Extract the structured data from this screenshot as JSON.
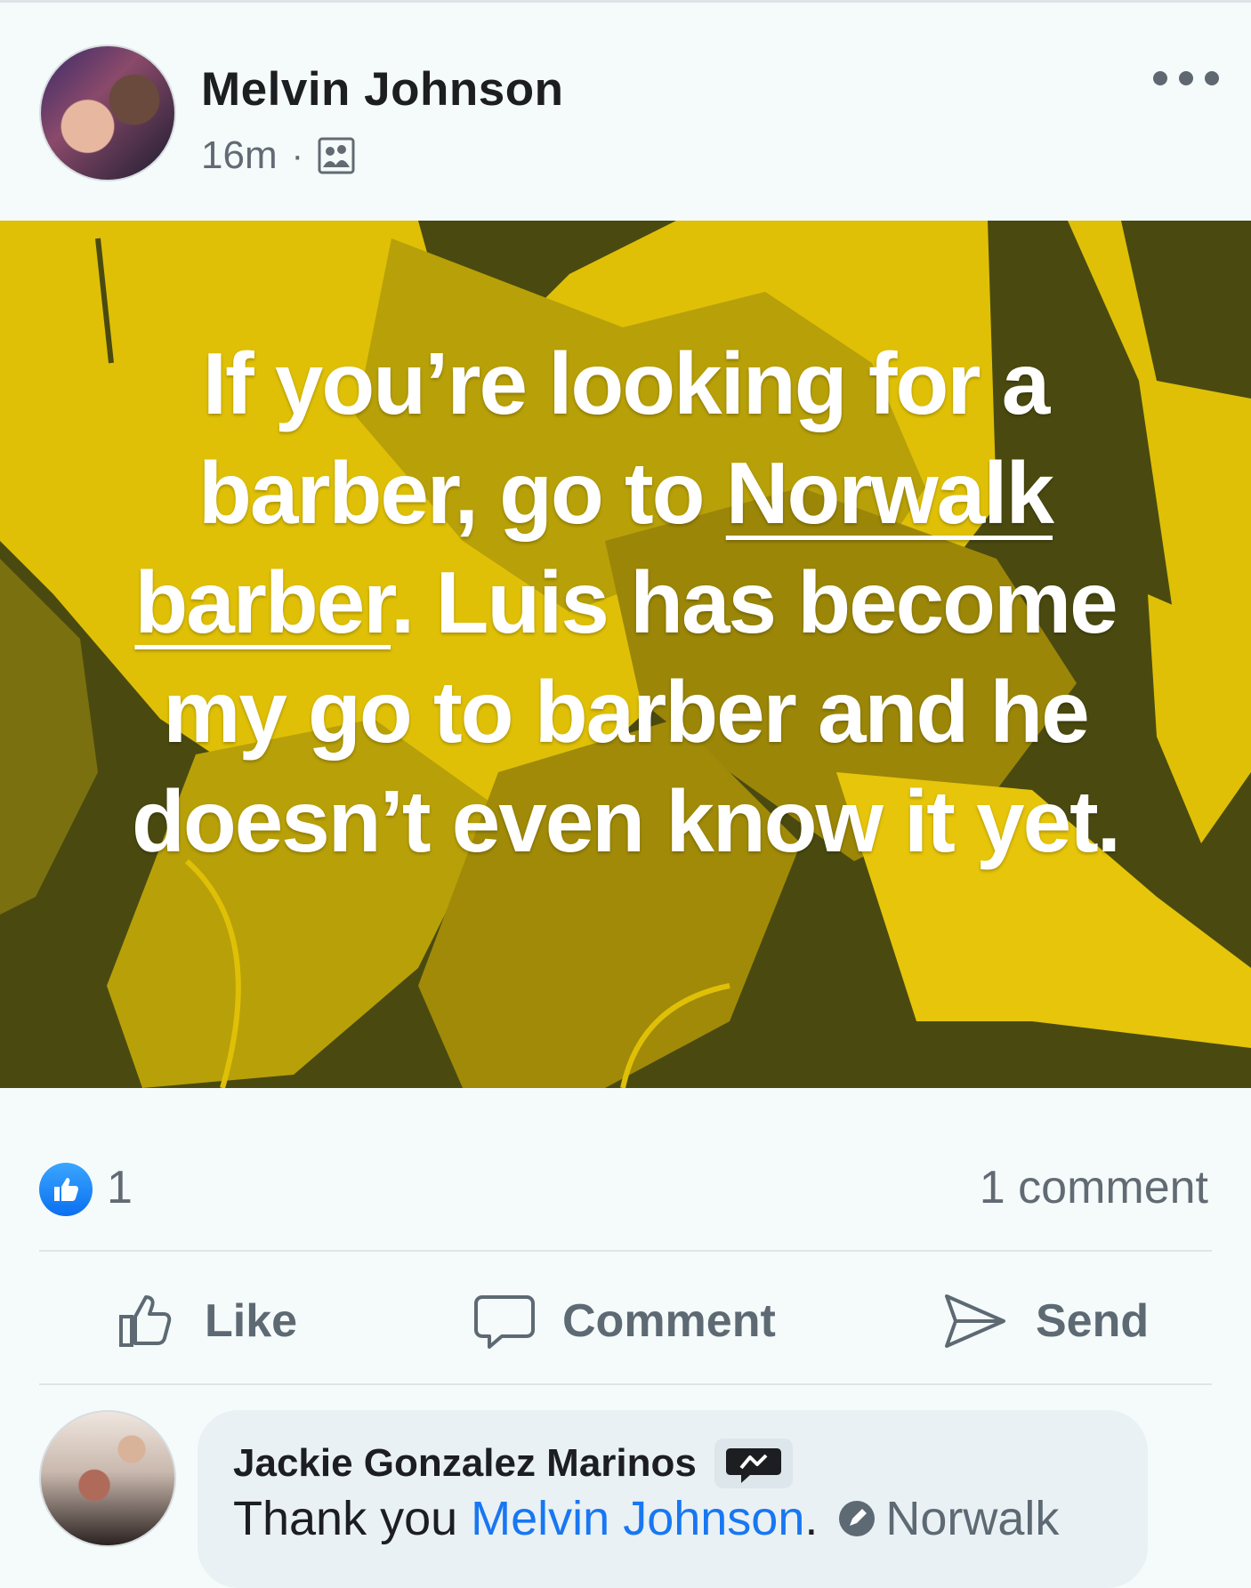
{
  "post": {
    "author": "Melvin Johnson",
    "time": "16m",
    "separator": "·",
    "audience_icon": "group-audience-icon",
    "more_icon": "more-options-icon",
    "background_colors": {
      "light": "#dfc007",
      "mid": "#b8a008",
      "dark": "#474710"
    },
    "text": {
      "part1": "If you’re looking for a barber, go to ",
      "link": "Norwalk barber",
      "part2": ". Luis has become my go to barber and he doesn’t even know it yet."
    }
  },
  "reactions": {
    "like_count": "1",
    "comment_count": "1 comment",
    "accent_color": "#1877f2"
  },
  "actions": {
    "like": "Like",
    "comment": "Comment",
    "send": "Send"
  },
  "comment": {
    "author": "Jackie Gonzalez Marinos",
    "badge_icon": "top-fan-badge-icon",
    "text_start": "Thank you ",
    "mention": "Melvin Johnson",
    "text_end": ".",
    "location": "Norwalk"
  }
}
